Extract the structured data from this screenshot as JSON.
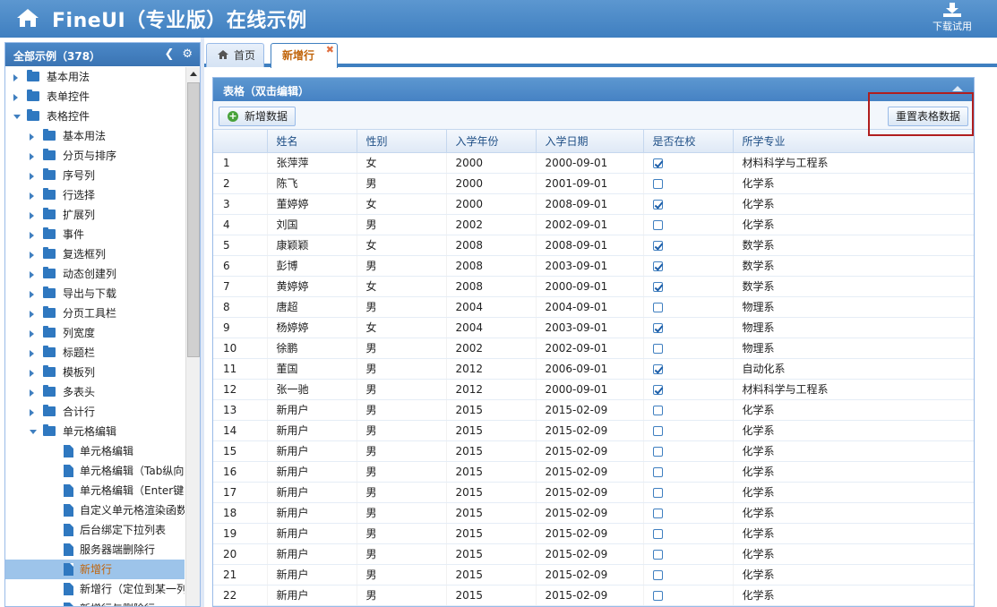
{
  "header": {
    "title": "FineUI（专业版）在线示例",
    "download_label": "下载试用"
  },
  "sidebar": {
    "title": "全部示例（378）",
    "nodes": [
      {
        "label": "基本用法",
        "level": 0,
        "type": "folder",
        "expanded": false
      },
      {
        "label": "表单控件",
        "level": 0,
        "type": "folder",
        "expanded": false
      },
      {
        "label": "表格控件",
        "level": 0,
        "type": "folder",
        "expanded": true
      },
      {
        "label": "基本用法",
        "level": 1,
        "type": "folder",
        "expanded": false
      },
      {
        "label": "分页与排序",
        "level": 1,
        "type": "folder",
        "expanded": false
      },
      {
        "label": "序号列",
        "level": 1,
        "type": "folder",
        "expanded": false
      },
      {
        "label": "行选择",
        "level": 1,
        "type": "folder",
        "expanded": false
      },
      {
        "label": "扩展列",
        "level": 1,
        "type": "folder",
        "expanded": false
      },
      {
        "label": "事件",
        "level": 1,
        "type": "folder",
        "expanded": false
      },
      {
        "label": "复选框列",
        "level": 1,
        "type": "folder",
        "expanded": false
      },
      {
        "label": "动态创建列",
        "level": 1,
        "type": "folder",
        "expanded": false
      },
      {
        "label": "导出与下载",
        "level": 1,
        "type": "folder",
        "expanded": false
      },
      {
        "label": "分页工具栏",
        "level": 1,
        "type": "folder",
        "expanded": false
      },
      {
        "label": "列宽度",
        "level": 1,
        "type": "folder",
        "expanded": false
      },
      {
        "label": "标题栏",
        "level": 1,
        "type": "folder",
        "expanded": false
      },
      {
        "label": "模板列",
        "level": 1,
        "type": "folder",
        "expanded": false
      },
      {
        "label": "多表头",
        "level": 1,
        "type": "folder",
        "expanded": false
      },
      {
        "label": "合计行",
        "level": 1,
        "type": "folder",
        "expanded": false
      },
      {
        "label": "单元格编辑",
        "level": 1,
        "type": "folder",
        "expanded": true
      },
      {
        "label": "单元格编辑",
        "level": 2,
        "type": "file"
      },
      {
        "label": "单元格编辑（Tab纵向",
        "level": 2,
        "type": "file"
      },
      {
        "label": "单元格编辑（Enter键",
        "level": 2,
        "type": "file"
      },
      {
        "label": "自定义单元格渲染函数",
        "level": 2,
        "type": "file"
      },
      {
        "label": "后台绑定下拉列表",
        "level": 2,
        "type": "file"
      },
      {
        "label": "服务器端删除行",
        "level": 2,
        "type": "file"
      },
      {
        "label": "新增行",
        "level": 2,
        "type": "file",
        "selected": true
      },
      {
        "label": "新增行（定位到某一列",
        "level": 2,
        "type": "file"
      },
      {
        "label": "新增行与删除行",
        "level": 2,
        "type": "file"
      }
    ]
  },
  "tabs": {
    "home_label": "首页",
    "active_label": "新增行",
    "close_glyph": "✖"
  },
  "panel": {
    "title": "表格（双击编辑）",
    "add_button": "新增数据",
    "reset_button": "重置表格数据"
  },
  "grid": {
    "columns": [
      "",
      "姓名",
      "性别",
      "入学年份",
      "入学日期",
      "是否在校",
      "所学专业"
    ],
    "rows": [
      [
        "1",
        "张萍萍",
        "女",
        "2000",
        "2000-09-01",
        true,
        "材料科学与工程系"
      ],
      [
        "2",
        "陈飞",
        "男",
        "2000",
        "2001-09-01",
        false,
        "化学系"
      ],
      [
        "3",
        "董婷婷",
        "女",
        "2000",
        "2008-09-01",
        true,
        "化学系"
      ],
      [
        "4",
        "刘国",
        "男",
        "2002",
        "2002-09-01",
        false,
        "化学系"
      ],
      [
        "5",
        "康颖颖",
        "女",
        "2008",
        "2008-09-01",
        true,
        "数学系"
      ],
      [
        "6",
        "彭博",
        "男",
        "2008",
        "2003-09-01",
        true,
        "数学系"
      ],
      [
        "7",
        "黄婷婷",
        "女",
        "2008",
        "2000-09-01",
        true,
        "数学系"
      ],
      [
        "8",
        "唐超",
        "男",
        "2004",
        "2004-09-01",
        false,
        "物理系"
      ],
      [
        "9",
        "杨婷婷",
        "女",
        "2004",
        "2003-09-01",
        true,
        "物理系"
      ],
      [
        "10",
        "徐鹏",
        "男",
        "2002",
        "2002-09-01",
        false,
        "物理系"
      ],
      [
        "11",
        "董国",
        "男",
        "2012",
        "2006-09-01",
        true,
        "自动化系"
      ],
      [
        "12",
        "张一驰",
        "男",
        "2012",
        "2000-09-01",
        true,
        "材料科学与工程系"
      ],
      [
        "13",
        "新用户",
        "男",
        "2015",
        "2015-02-09",
        false,
        "化学系"
      ],
      [
        "14",
        "新用户",
        "男",
        "2015",
        "2015-02-09",
        false,
        "化学系"
      ],
      [
        "15",
        "新用户",
        "男",
        "2015",
        "2015-02-09",
        false,
        "化学系"
      ],
      [
        "16",
        "新用户",
        "男",
        "2015",
        "2015-02-09",
        false,
        "化学系"
      ],
      [
        "17",
        "新用户",
        "男",
        "2015",
        "2015-02-09",
        false,
        "化学系"
      ],
      [
        "18",
        "新用户",
        "男",
        "2015",
        "2015-02-09",
        false,
        "化学系"
      ],
      [
        "19",
        "新用户",
        "男",
        "2015",
        "2015-02-09",
        false,
        "化学系"
      ],
      [
        "20",
        "新用户",
        "男",
        "2015",
        "2015-02-09",
        false,
        "化学系"
      ],
      [
        "21",
        "新用户",
        "男",
        "2015",
        "2015-02-09",
        false,
        "化学系"
      ],
      [
        "22",
        "新用户",
        "男",
        "2015",
        "2015-02-09",
        false,
        "化学系"
      ]
    ]
  }
}
